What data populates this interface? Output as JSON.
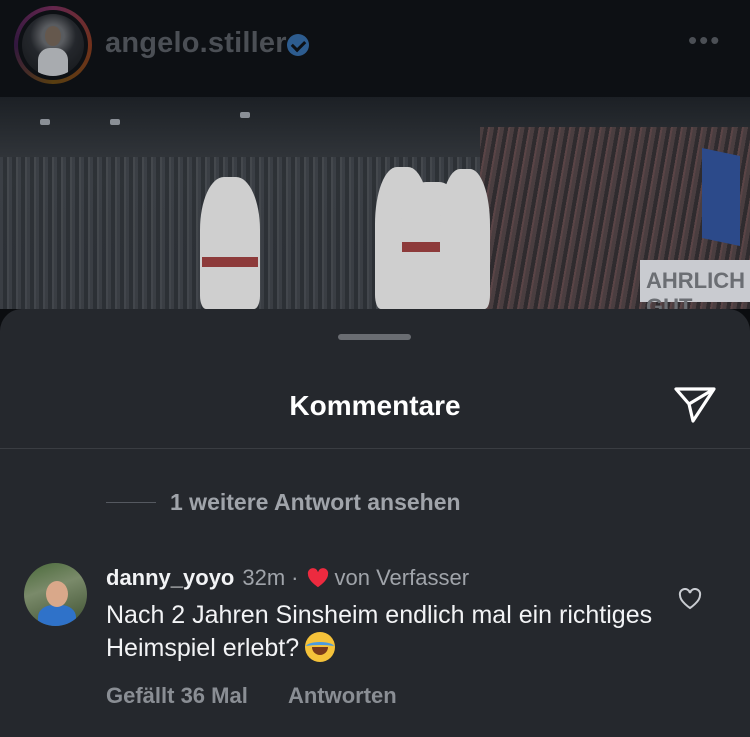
{
  "post_header": {
    "username": "angelo.stiller",
    "more_icon": "more-horizontal-icon"
  },
  "hero": {
    "banner_text": "AHRLICH GUT"
  },
  "comments_sheet": {
    "title": "Kommentare",
    "send_icon": "paper-plane-icon",
    "view_replies": "1 weitere Antwort ansehen"
  },
  "comment": {
    "username": "danny_yoyo",
    "time": "32m",
    "separator": "·",
    "author_badge": "von Verfasser",
    "text": "Nach 2 Jahren Sinsheim endlich mal ein richtiges Heimspiel erlebt?",
    "emoji": "face-with-tears-of-joy",
    "likes_label": "Gefällt 36 Mal",
    "reply_label": "Antworten"
  },
  "colors": {
    "sheet_bg": "#25282d",
    "header_bg": "#0d1014",
    "heart_red": "#ed2a3f"
  }
}
